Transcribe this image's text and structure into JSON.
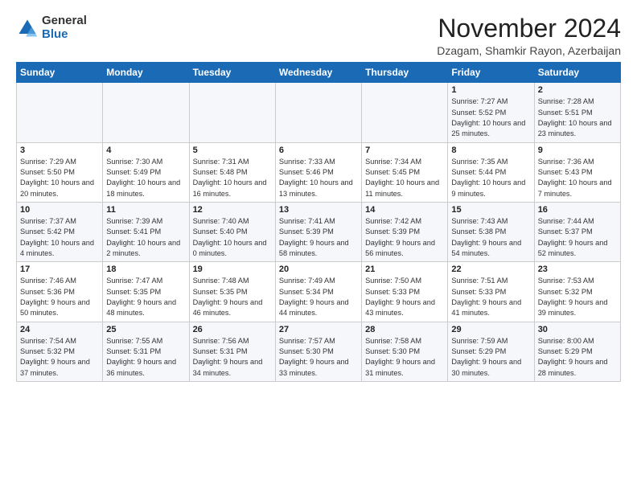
{
  "logo": {
    "general": "General",
    "blue": "Blue"
  },
  "title": "November 2024",
  "location": "Dzagam, Shamkir Rayon, Azerbaijan",
  "weekdays": [
    "Sunday",
    "Monday",
    "Tuesday",
    "Wednesday",
    "Thursday",
    "Friday",
    "Saturday"
  ],
  "weeks": [
    [
      {
        "day": "",
        "info": ""
      },
      {
        "day": "",
        "info": ""
      },
      {
        "day": "",
        "info": ""
      },
      {
        "day": "",
        "info": ""
      },
      {
        "day": "",
        "info": ""
      },
      {
        "day": "1",
        "info": "Sunrise: 7:27 AM\nSunset: 5:52 PM\nDaylight: 10 hours and 25 minutes."
      },
      {
        "day": "2",
        "info": "Sunrise: 7:28 AM\nSunset: 5:51 PM\nDaylight: 10 hours and 23 minutes."
      }
    ],
    [
      {
        "day": "3",
        "info": "Sunrise: 7:29 AM\nSunset: 5:50 PM\nDaylight: 10 hours and 20 minutes."
      },
      {
        "day": "4",
        "info": "Sunrise: 7:30 AM\nSunset: 5:49 PM\nDaylight: 10 hours and 18 minutes."
      },
      {
        "day": "5",
        "info": "Sunrise: 7:31 AM\nSunset: 5:48 PM\nDaylight: 10 hours and 16 minutes."
      },
      {
        "day": "6",
        "info": "Sunrise: 7:33 AM\nSunset: 5:46 PM\nDaylight: 10 hours and 13 minutes."
      },
      {
        "day": "7",
        "info": "Sunrise: 7:34 AM\nSunset: 5:45 PM\nDaylight: 10 hours and 11 minutes."
      },
      {
        "day": "8",
        "info": "Sunrise: 7:35 AM\nSunset: 5:44 PM\nDaylight: 10 hours and 9 minutes."
      },
      {
        "day": "9",
        "info": "Sunrise: 7:36 AM\nSunset: 5:43 PM\nDaylight: 10 hours and 7 minutes."
      }
    ],
    [
      {
        "day": "10",
        "info": "Sunrise: 7:37 AM\nSunset: 5:42 PM\nDaylight: 10 hours and 4 minutes."
      },
      {
        "day": "11",
        "info": "Sunrise: 7:39 AM\nSunset: 5:41 PM\nDaylight: 10 hours and 2 minutes."
      },
      {
        "day": "12",
        "info": "Sunrise: 7:40 AM\nSunset: 5:40 PM\nDaylight: 10 hours and 0 minutes."
      },
      {
        "day": "13",
        "info": "Sunrise: 7:41 AM\nSunset: 5:39 PM\nDaylight: 9 hours and 58 minutes."
      },
      {
        "day": "14",
        "info": "Sunrise: 7:42 AM\nSunset: 5:39 PM\nDaylight: 9 hours and 56 minutes."
      },
      {
        "day": "15",
        "info": "Sunrise: 7:43 AM\nSunset: 5:38 PM\nDaylight: 9 hours and 54 minutes."
      },
      {
        "day": "16",
        "info": "Sunrise: 7:44 AM\nSunset: 5:37 PM\nDaylight: 9 hours and 52 minutes."
      }
    ],
    [
      {
        "day": "17",
        "info": "Sunrise: 7:46 AM\nSunset: 5:36 PM\nDaylight: 9 hours and 50 minutes."
      },
      {
        "day": "18",
        "info": "Sunrise: 7:47 AM\nSunset: 5:35 PM\nDaylight: 9 hours and 48 minutes."
      },
      {
        "day": "19",
        "info": "Sunrise: 7:48 AM\nSunset: 5:35 PM\nDaylight: 9 hours and 46 minutes."
      },
      {
        "day": "20",
        "info": "Sunrise: 7:49 AM\nSunset: 5:34 PM\nDaylight: 9 hours and 44 minutes."
      },
      {
        "day": "21",
        "info": "Sunrise: 7:50 AM\nSunset: 5:33 PM\nDaylight: 9 hours and 43 minutes."
      },
      {
        "day": "22",
        "info": "Sunrise: 7:51 AM\nSunset: 5:33 PM\nDaylight: 9 hours and 41 minutes."
      },
      {
        "day": "23",
        "info": "Sunrise: 7:53 AM\nSunset: 5:32 PM\nDaylight: 9 hours and 39 minutes."
      }
    ],
    [
      {
        "day": "24",
        "info": "Sunrise: 7:54 AM\nSunset: 5:32 PM\nDaylight: 9 hours and 37 minutes."
      },
      {
        "day": "25",
        "info": "Sunrise: 7:55 AM\nSunset: 5:31 PM\nDaylight: 9 hours and 36 minutes."
      },
      {
        "day": "26",
        "info": "Sunrise: 7:56 AM\nSunset: 5:31 PM\nDaylight: 9 hours and 34 minutes."
      },
      {
        "day": "27",
        "info": "Sunrise: 7:57 AM\nSunset: 5:30 PM\nDaylight: 9 hours and 33 minutes."
      },
      {
        "day": "28",
        "info": "Sunrise: 7:58 AM\nSunset: 5:30 PM\nDaylight: 9 hours and 31 minutes."
      },
      {
        "day": "29",
        "info": "Sunrise: 7:59 AM\nSunset: 5:29 PM\nDaylight: 9 hours and 30 minutes."
      },
      {
        "day": "30",
        "info": "Sunrise: 8:00 AM\nSunset: 5:29 PM\nDaylight: 9 hours and 28 minutes."
      }
    ]
  ]
}
